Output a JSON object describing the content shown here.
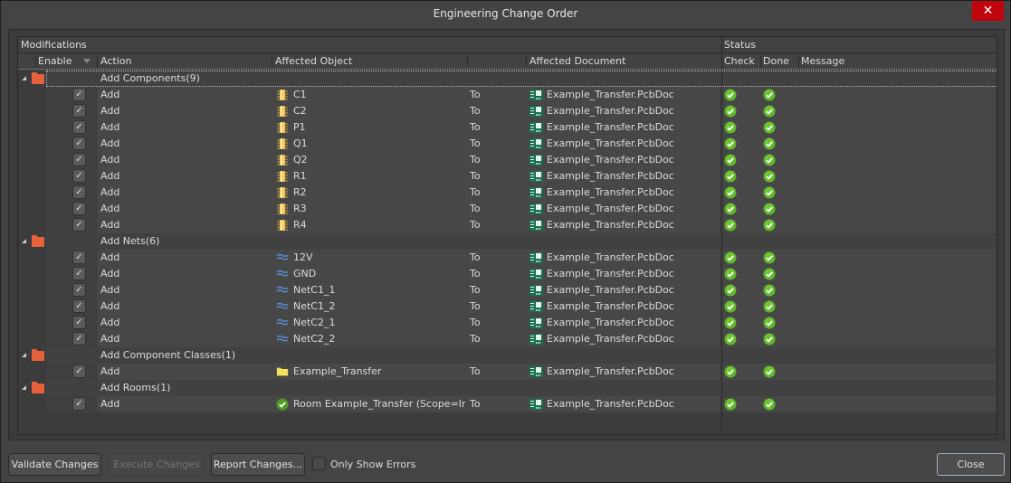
{
  "window": {
    "title": "Engineering Change Order",
    "close_icon": "close-icon"
  },
  "headers": {
    "group_left": "Modifications",
    "group_right": "Status",
    "enable": "Enable",
    "action": "Action",
    "affected_object": "Affected Object",
    "affected_document": "Affected Document",
    "check": "Check",
    "done": "Done",
    "message": "Message"
  },
  "groups": [
    {
      "label": "Add Components(9)",
      "item_icon": "component-icon",
      "items": [
        {
          "enabled": true,
          "action": "Add",
          "object": "C1",
          "to": "To",
          "document": "Example_Transfer.PcbDoc",
          "check": "ok",
          "done": "ok"
        },
        {
          "enabled": true,
          "action": "Add",
          "object": "C2",
          "to": "To",
          "document": "Example_Transfer.PcbDoc",
          "check": "ok",
          "done": "ok"
        },
        {
          "enabled": true,
          "action": "Add",
          "object": "P1",
          "to": "To",
          "document": "Example_Transfer.PcbDoc",
          "check": "ok",
          "done": "ok"
        },
        {
          "enabled": true,
          "action": "Add",
          "object": "Q1",
          "to": "To",
          "document": "Example_Transfer.PcbDoc",
          "check": "ok",
          "done": "ok"
        },
        {
          "enabled": true,
          "action": "Add",
          "object": "Q2",
          "to": "To",
          "document": "Example_Transfer.PcbDoc",
          "check": "ok",
          "done": "ok"
        },
        {
          "enabled": true,
          "action": "Add",
          "object": "R1",
          "to": "To",
          "document": "Example_Transfer.PcbDoc",
          "check": "ok",
          "done": "ok"
        },
        {
          "enabled": true,
          "action": "Add",
          "object": "R2",
          "to": "To",
          "document": "Example_Transfer.PcbDoc",
          "check": "ok",
          "done": "ok"
        },
        {
          "enabled": true,
          "action": "Add",
          "object": "R3",
          "to": "To",
          "document": "Example_Transfer.PcbDoc",
          "check": "ok",
          "done": "ok"
        },
        {
          "enabled": true,
          "action": "Add",
          "object": "R4",
          "to": "To",
          "document": "Example_Transfer.PcbDoc",
          "check": "ok",
          "done": "ok"
        }
      ]
    },
    {
      "label": "Add Nets(6)",
      "item_icon": "net-icon",
      "items": [
        {
          "enabled": true,
          "action": "Add",
          "object": "12V",
          "to": "To",
          "document": "Example_Transfer.PcbDoc",
          "check": "ok",
          "done": "ok"
        },
        {
          "enabled": true,
          "action": "Add",
          "object": "GND",
          "to": "To",
          "document": "Example_Transfer.PcbDoc",
          "check": "ok",
          "done": "ok"
        },
        {
          "enabled": true,
          "action": "Add",
          "object": "NetC1_1",
          "to": "To",
          "document": "Example_Transfer.PcbDoc",
          "check": "ok",
          "done": "ok"
        },
        {
          "enabled": true,
          "action": "Add",
          "object": "NetC1_2",
          "to": "To",
          "document": "Example_Transfer.PcbDoc",
          "check": "ok",
          "done": "ok"
        },
        {
          "enabled": true,
          "action": "Add",
          "object": "NetC2_1",
          "to": "To",
          "document": "Example_Transfer.PcbDoc",
          "check": "ok",
          "done": "ok"
        },
        {
          "enabled": true,
          "action": "Add",
          "object": "NetC2_2",
          "to": "To",
          "document": "Example_Transfer.PcbDoc",
          "check": "ok",
          "done": "ok"
        }
      ]
    },
    {
      "label": "Add Component Classes(1)",
      "item_icon": "class-folder-icon",
      "items": [
        {
          "enabled": true,
          "action": "Add",
          "object": "Example_Transfer",
          "to": "To",
          "document": "Example_Transfer.PcbDoc",
          "check": "ok",
          "done": "ok"
        }
      ]
    },
    {
      "label": "Add Rooms(1)",
      "item_icon": "room-icon",
      "items": [
        {
          "enabled": true,
          "action": "Add",
          "object": "Room Example_Transfer (Scope=InComponentClass('Example_Transfer'))",
          "to": "To",
          "document": "Example_Transfer.PcbDoc",
          "check": "ok",
          "done": "ok"
        }
      ]
    }
  ],
  "footer": {
    "validate": "Validate Changes",
    "execute": "Execute Changes",
    "report": "Report Changes...",
    "only_errors": "Only Show Errors",
    "close": "Close"
  },
  "colors": {
    "accent_close": "#c1050d",
    "status_ok": "#5fb82a",
    "group_folder": "#e7623b",
    "net_icon": "#5b8fd9",
    "doc_icon": "#1c8a5a"
  }
}
